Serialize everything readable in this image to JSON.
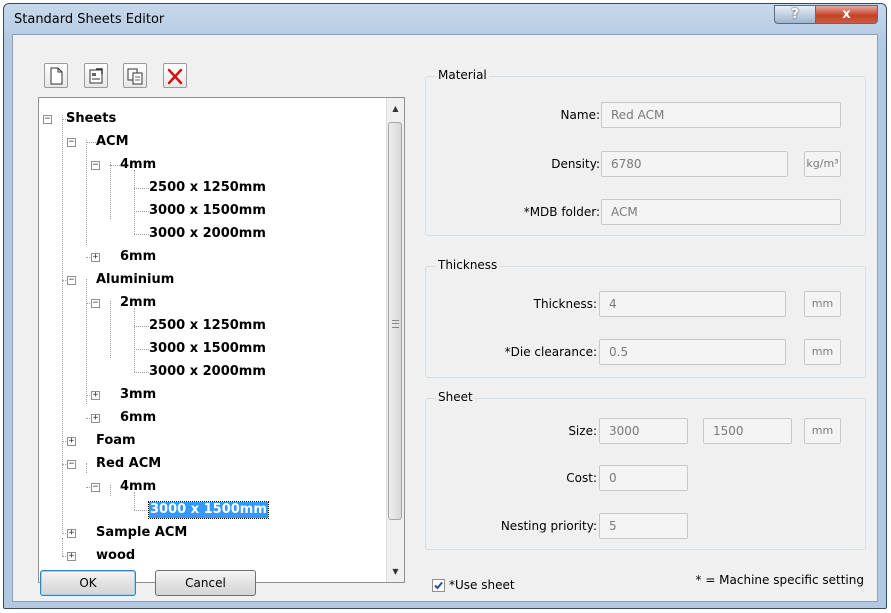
{
  "window": {
    "title": "Standard Sheets Editor",
    "help_label": "?",
    "close_label": "x"
  },
  "tree": {
    "nodes": [
      {
        "label": "Sheets",
        "expander": "−"
      },
      {
        "label": "ACM",
        "expander": "−"
      },
      {
        "label": "4mm",
        "expander": "−"
      },
      {
        "label": "2500 x 1250mm"
      },
      {
        "label": "3000 x 1500mm"
      },
      {
        "label": "3000 x 2000mm"
      },
      {
        "label": "6mm",
        "expander": "+"
      },
      {
        "label": "Aluminium",
        "expander": "−"
      },
      {
        "label": "2mm",
        "expander": "−"
      },
      {
        "label": "2500 x 1250mm"
      },
      {
        "label": "3000 x 1500mm"
      },
      {
        "label": "3000 x 2000mm"
      },
      {
        "label": "3mm",
        "expander": "+"
      },
      {
        "label": "6mm",
        "expander": "+"
      },
      {
        "label": "Foam",
        "expander": "+"
      },
      {
        "label": "Red ACM",
        "expander": "−"
      },
      {
        "label": "4mm",
        "expander": "−"
      },
      {
        "label": "3000 x 1500mm",
        "selected": true
      },
      {
        "label": "Sample ACM",
        "expander": "+"
      },
      {
        "label": "wood",
        "expander": "+"
      }
    ]
  },
  "material": {
    "title": "Material",
    "name_label": "Name:",
    "name_value": "Red ACM",
    "density_label": "Density:",
    "density_value": "6780",
    "density_unit": "kg/m³",
    "folder_label": "*MDB folder:",
    "folder_value": "ACM"
  },
  "thickness": {
    "title": "Thickness",
    "thickness_label": "Thickness:",
    "thickness_value": "4",
    "thickness_unit": "mm",
    "clearance_label": "*Die clearance:",
    "clearance_value": "0.5",
    "clearance_unit": "mm"
  },
  "sheet": {
    "title": "Sheet",
    "size_label": "Size:",
    "width_value": "3000",
    "height_value": "1500",
    "size_unit": "mm",
    "cost_label": "Cost:",
    "cost_value": "0",
    "priority_label": "Nesting priority:",
    "priority_value": "5"
  },
  "footer": {
    "ok_label": "OK",
    "cancel_label": "Cancel",
    "use_sheet_label": "*Use sheet",
    "use_sheet_checked": true,
    "note": "* = Machine specific setting"
  },
  "colors": {
    "selection": "#3399ff",
    "window_frame": "#b3c9e1",
    "dialog_bg": "#f0f0f0"
  }
}
